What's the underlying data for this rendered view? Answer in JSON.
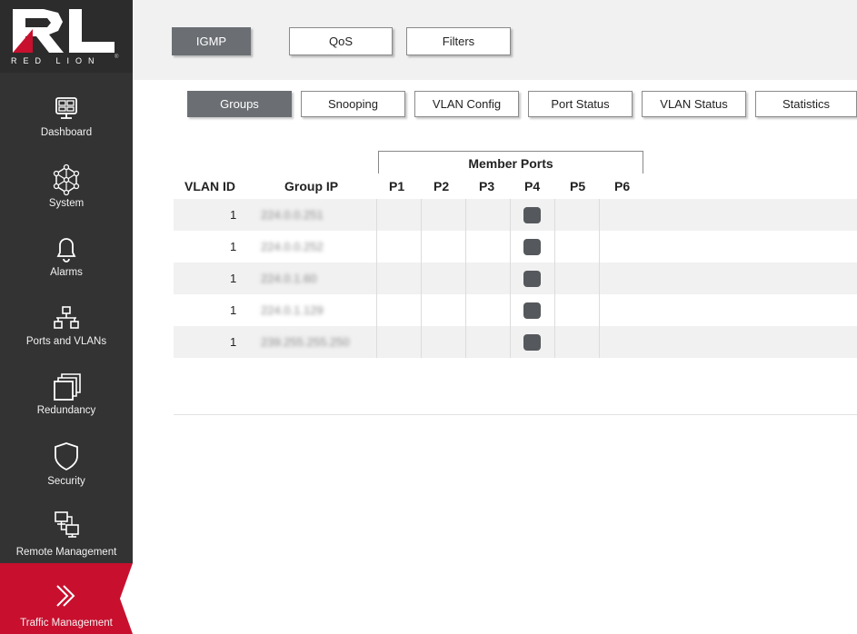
{
  "brand": {
    "name": "RED LION",
    "logo_letters": "RL"
  },
  "sidebar": {
    "items": [
      {
        "label": "Dashboard",
        "icon": "dashboard-icon"
      },
      {
        "label": "System",
        "icon": "system-network-icon"
      },
      {
        "label": "Alarms",
        "icon": "bell-icon"
      },
      {
        "label": "Ports and VLANs",
        "icon": "network-tree-icon"
      },
      {
        "label": "Redundancy",
        "icon": "stacked-windows-icon"
      },
      {
        "label": "Security",
        "icon": "shield-icon"
      },
      {
        "label": "Remote Management",
        "icon": "remote-computers-icon"
      },
      {
        "label": "Traffic Management",
        "icon": "double-chevron-icon",
        "active": true
      }
    ]
  },
  "top_tabs": [
    {
      "label": "IGMP",
      "active": true
    },
    {
      "label": "QoS"
    },
    {
      "label": "Filters"
    }
  ],
  "sub_tabs": [
    {
      "label": "Groups",
      "active": true
    },
    {
      "label": "Snooping"
    },
    {
      "label": "VLAN Config"
    },
    {
      "label": "Port Status"
    },
    {
      "label": "VLAN Status"
    },
    {
      "label": "Statistics"
    }
  ],
  "table": {
    "member_ports_header": "Member Ports",
    "columns": [
      "VLAN ID",
      "Group IP",
      "P1",
      "P2",
      "P3",
      "P4",
      "P5",
      "P6"
    ],
    "rows": [
      {
        "vlan_id": "1",
        "group_ip": "224.0.0.251",
        "ports": [
          false,
          false,
          false,
          true,
          false,
          false
        ]
      },
      {
        "vlan_id": "1",
        "group_ip": "224.0.0.252",
        "ports": [
          false,
          false,
          false,
          true,
          false,
          false
        ]
      },
      {
        "vlan_id": "1",
        "group_ip": "224.0.1.60",
        "ports": [
          false,
          false,
          false,
          true,
          false,
          false
        ]
      },
      {
        "vlan_id": "1",
        "group_ip": "224.0.1.129",
        "ports": [
          false,
          false,
          false,
          true,
          false,
          false
        ]
      },
      {
        "vlan_id": "1",
        "group_ip": "239.255.255.250",
        "ports": [
          false,
          false,
          false,
          true,
          false,
          false
        ]
      }
    ]
  },
  "colors": {
    "accent": "#c8102e",
    "sidebar": "#333333",
    "active_tab": "#6b6f74",
    "checked_port": "#55585c"
  }
}
